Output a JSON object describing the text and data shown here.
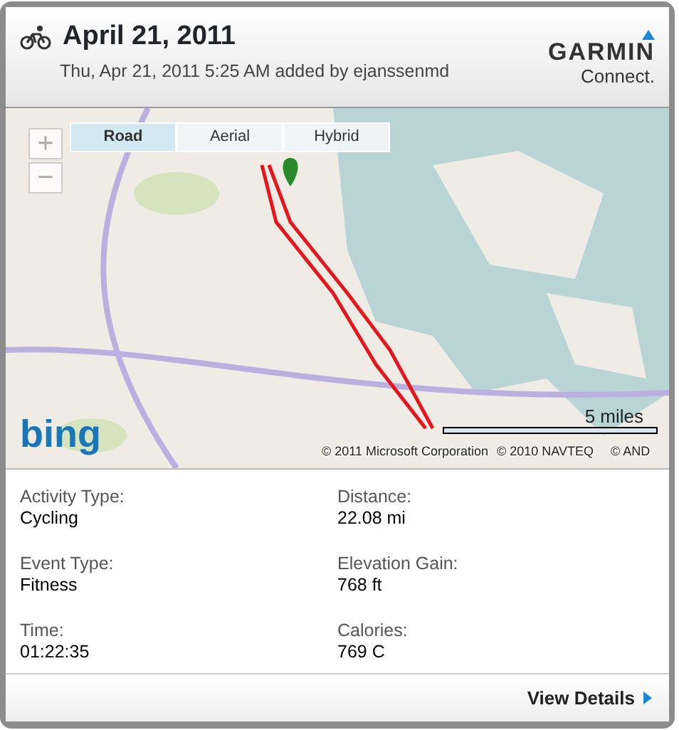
{
  "header": {
    "title": "April 21, 2011",
    "subtitle": "Thu, Apr 21, 2011 5:25 AM added by ejanssenmd",
    "logo": {
      "brand": "GARMIN",
      "product": "Connect."
    }
  },
  "map": {
    "kind": "picture",
    "zoom_buttons": [
      "+",
      "−"
    ],
    "map_types": [
      {
        "label": "Road",
        "selected": true
      },
      {
        "label": "Aerial",
        "selected": false
      },
      {
        "label": "Hybrid",
        "selected": false
      }
    ],
    "provider_logo": "bing",
    "scale": "5 miles",
    "copyright": [
      "© 2011 Microsoft Corporation",
      "© 2010 NAVTEQ",
      "© AND"
    ]
  },
  "stats": [
    {
      "label": "Activity Type:",
      "value": "Cycling"
    },
    {
      "label": "Distance:",
      "value": "22.08 mi"
    },
    {
      "label": "Event Type:",
      "value": "Fitness"
    },
    {
      "label": "Elevation Gain:",
      "value": "768 ft"
    },
    {
      "label": "Time:",
      "value": "01:22:35"
    },
    {
      "label": "Calories:",
      "value": "769 C"
    }
  ],
  "footer": {
    "link": "View Details"
  }
}
